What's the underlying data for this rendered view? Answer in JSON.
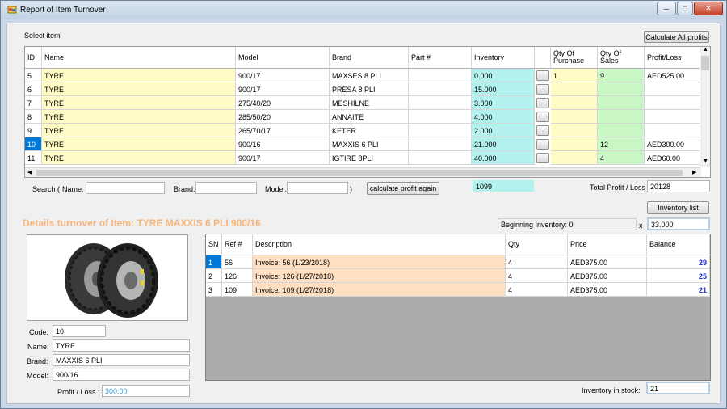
{
  "window": {
    "title": "Report of Item Turnover",
    "controls": {
      "minimize": "─",
      "maximize": "□",
      "close": "✕"
    }
  },
  "select_item": {
    "label": "Select item",
    "calc_all_label": "Calculate All profits",
    "columns": [
      "ID",
      "Name",
      "Model",
      "Brand",
      "Part #",
      "Inventory",
      "",
      "Qty Of Purchase",
      "Qty Of Sales",
      "Profit/Loss"
    ],
    "rows": [
      {
        "id": "5",
        "name": "TYRE",
        "model": "900/17",
        "brand": "MAXSES  8 PLI",
        "part": "",
        "inventory": "0.000",
        "purchase": "1",
        "sales": "9",
        "profit": "AED525.00"
      },
      {
        "id": "6",
        "name": "TYRE",
        "model": "900/17",
        "brand": "PRESA 8 PLI",
        "part": "",
        "inventory": "15.000",
        "purchase": "",
        "sales": "",
        "profit": ""
      },
      {
        "id": "7",
        "name": "TYRE",
        "model": "275/40/20",
        "brand": "MESHILNE",
        "part": "",
        "inventory": "3.000",
        "purchase": "",
        "sales": "",
        "profit": ""
      },
      {
        "id": "8",
        "name": "TYRE",
        "model": "285/50/20",
        "brand": "ANNAITE",
        "part": "",
        "inventory": "4.000",
        "purchase": "",
        "sales": "",
        "profit": ""
      },
      {
        "id": "9",
        "name": "TYRE",
        "model": "265/70/17",
        "brand": "KETER",
        "part": "",
        "inventory": "2.000",
        "purchase": "",
        "sales": "",
        "profit": ""
      },
      {
        "id": "10",
        "name": "TYRE",
        "model": "900/16",
        "brand": "MAXXIS  6 PLI",
        "part": "",
        "inventory": "21.000",
        "purchase": "",
        "sales": "12",
        "profit": "AED300.00"
      },
      {
        "id": "11",
        "name": "TYRE",
        "model": "900/17",
        "brand": "IGTIRE  8PLI",
        "part": "",
        "inventory": "40.000",
        "purchase": "",
        "sales": "4",
        "profit": "AED60.00"
      }
    ]
  },
  "search": {
    "label": "Search (",
    "name_label": "Name:",
    "brand_label": "Brand:",
    "model_label": "Model:",
    "close_paren": ")",
    "recalc_label": "calculate profit again",
    "inventory_total": "1099",
    "total_label": "Total Profit / Loss :",
    "total_value": "20128"
  },
  "details": {
    "title": "Details  turnover of Item: TYRE MAXXIS  6 PLI 900/16",
    "inventory_list_label": "Inventory list",
    "beginning_label": "Beginning Inventory: 0",
    "x_label": "x",
    "beginning_value": "33.000",
    "code_label": "Code:",
    "code": "10",
    "name_label": "Name:",
    "name": "TYRE",
    "brand_label": "Brand:",
    "brand": "MAXXIS  6 PLI",
    "model_label": "Model:",
    "model": "900/16",
    "profit_label": "Profit / Loss :",
    "profit": "300.00",
    "stock_label": "Inventory in stock:",
    "stock": "21"
  },
  "transactions": {
    "columns": [
      "SN",
      "Ref #",
      "Description",
      "Qty",
      "Price",
      "Balance"
    ],
    "rows": [
      {
        "sn": "1",
        "ref": "56",
        "desc": "Invoice: 56 (1/23/2018)",
        "qty": "4",
        "price": "AED375.00",
        "balance": "29"
      },
      {
        "sn": "2",
        "ref": "126",
        "desc": "Invoice: 126 (1/27/2018)",
        "qty": "4",
        "price": "AED375.00",
        "balance": "25"
      },
      {
        "sn": "3",
        "ref": "109",
        "desc": "Invoice: 109 (1/27/2018)",
        "qty": "4",
        "price": "AED375.00",
        "balance": "21"
      }
    ]
  },
  "colors": {
    "details_title": "#f7b57a",
    "balance": "#1f2fd0",
    "selection": "#0078d7",
    "yellow": "#fffbc6",
    "cyan": "#b3f1ee",
    "green": "#c9f7c6",
    "peach": "#ffdfc2"
  }
}
